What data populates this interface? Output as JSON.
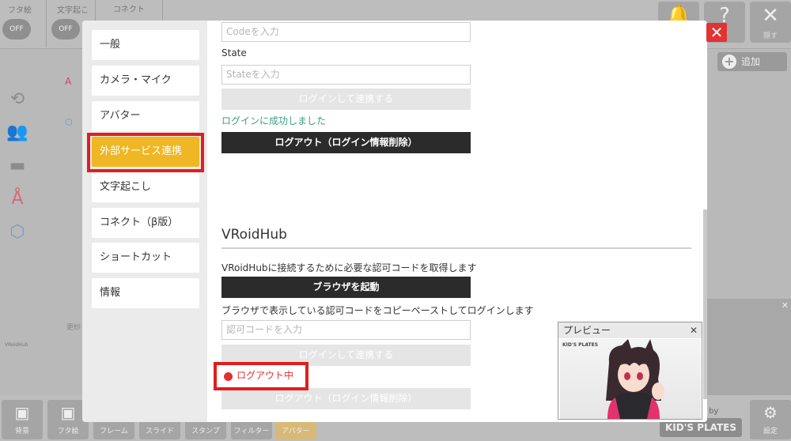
{
  "background": {
    "toggles": [
      {
        "label": "フタ絵",
        "state": "OFF"
      },
      {
        "label": "文字起こ",
        "state": "OFF"
      }
    ],
    "connect_label": "コネクト",
    "top_buttons": [
      {
        "icon": "bell-icon",
        "glyph": "🔔",
        "label": ""
      },
      {
        "icon": "help-icon",
        "glyph": "?",
        "label": "プ"
      },
      {
        "icon": "close-icon",
        "glyph": "✕",
        "label": "隠す"
      }
    ],
    "add_button": "追加",
    "side_label": "VRoidHub",
    "side_text": "更紗",
    "bottom_buttons": [
      "背景",
      "フタ絵",
      "フレーム",
      "スライド",
      "スタンプ",
      "フィルター",
      "アバター"
    ],
    "brand": "KID'S PLATES",
    "by_text": "by",
    "settings_label": "設定"
  },
  "dialog": {
    "close_glyph": "✕",
    "nav": [
      "一般",
      "カメラ・マイク",
      "アバター",
      "外部サービス連携",
      "文字起こし",
      "コネクト（β版）",
      "ショートカット",
      "情報"
    ],
    "active_nav_index": 3,
    "accent_color": "#eeb723",
    "code_placeholder": "Codeを入力",
    "state_label": "State",
    "state_placeholder": "Stateを入力",
    "login_button_1": "ログインして連携する",
    "login_success": "ログインに成功しました",
    "logout_button_1": "ログアウト（ログイン情報削除）",
    "vroid": {
      "title": "VRoidHub",
      "description": "VRoidHubに接続するために必要な認可コードを取得します",
      "browser_button": "ブラウザを起動",
      "instruction": "ブラウザで表示している認可コードをコピーペーストしてログインします",
      "auth_placeholder": "認可コードを入力",
      "login_button": "ログインして連携する",
      "status": "ログアウト中",
      "logout_button": "ログアウト（ログイン情報削除）"
    }
  },
  "preview": {
    "title": "プレビュー",
    "close_glyph": "✕",
    "brand": "KID'S PLATES"
  }
}
